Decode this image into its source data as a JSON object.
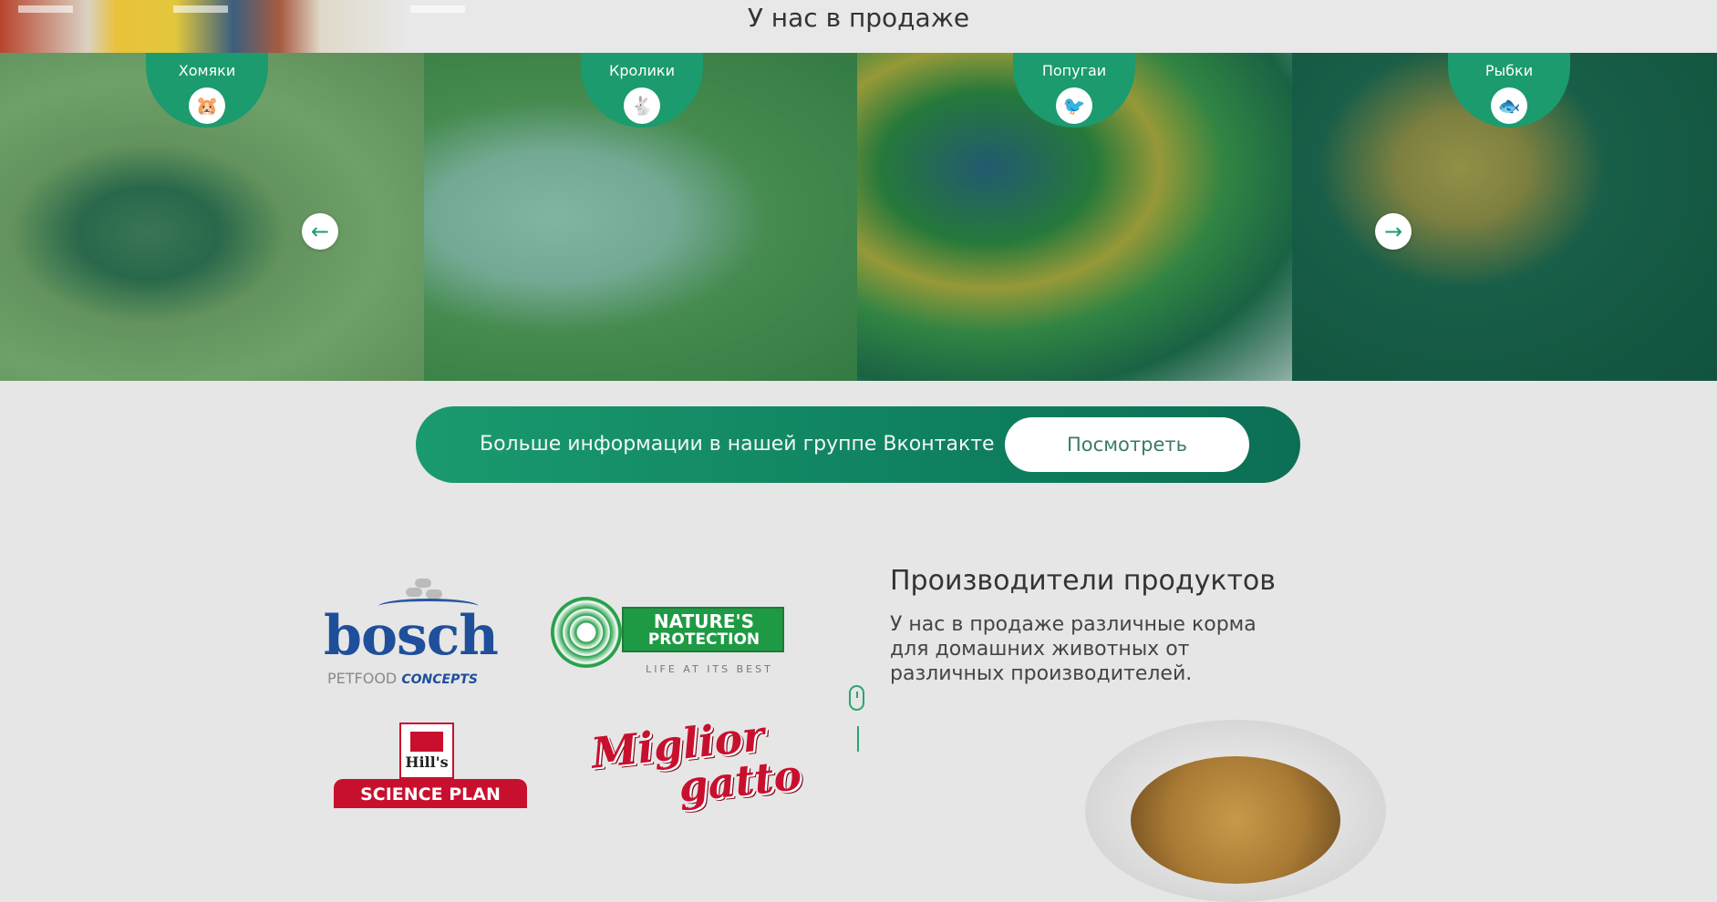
{
  "header": {
    "section_title": "У нас в продаже"
  },
  "gallery": {
    "cards": [
      {
        "label": "Хомяки",
        "icon": "hamster-icon",
        "glyph": "🐹"
      },
      {
        "label": "Кролики",
        "icon": "rabbit-icon",
        "glyph": "🐇"
      },
      {
        "label": "Попугаи",
        "icon": "parrot-icon",
        "glyph": "🐦"
      },
      {
        "label": "Рыбки",
        "icon": "fish-icon",
        "glyph": "🐟"
      }
    ],
    "prev_glyph": "←",
    "next_glyph": "→"
  },
  "vk_banner": {
    "text": "Больше информации в нашей группе Вконтакте",
    "button_label": "Посмотреть"
  },
  "producers": {
    "title": "Производители продуктов",
    "description": "У нас в продаже различные корма для домашних животных от различных производителей.",
    "logos": [
      {
        "name": "bosch",
        "line1": "bosch",
        "line2": "PETFOOD",
        "line3": "CONCEPTS"
      },
      {
        "name": "natures-protection",
        "line1": "NATURE'S",
        "line2": "PROTECTION",
        "line3": "LIFE AT ITS BEST"
      },
      {
        "name": "hills",
        "line1": "Hill's",
        "line2": "SCIENCE PLAN"
      },
      {
        "name": "migliorgatto",
        "line1": "Miglior",
        "line2": "gatto"
      }
    ]
  },
  "colors": {
    "accent": "#1b9b6e",
    "banner_dark": "#0c6f55",
    "background": "#e6e6e6"
  }
}
